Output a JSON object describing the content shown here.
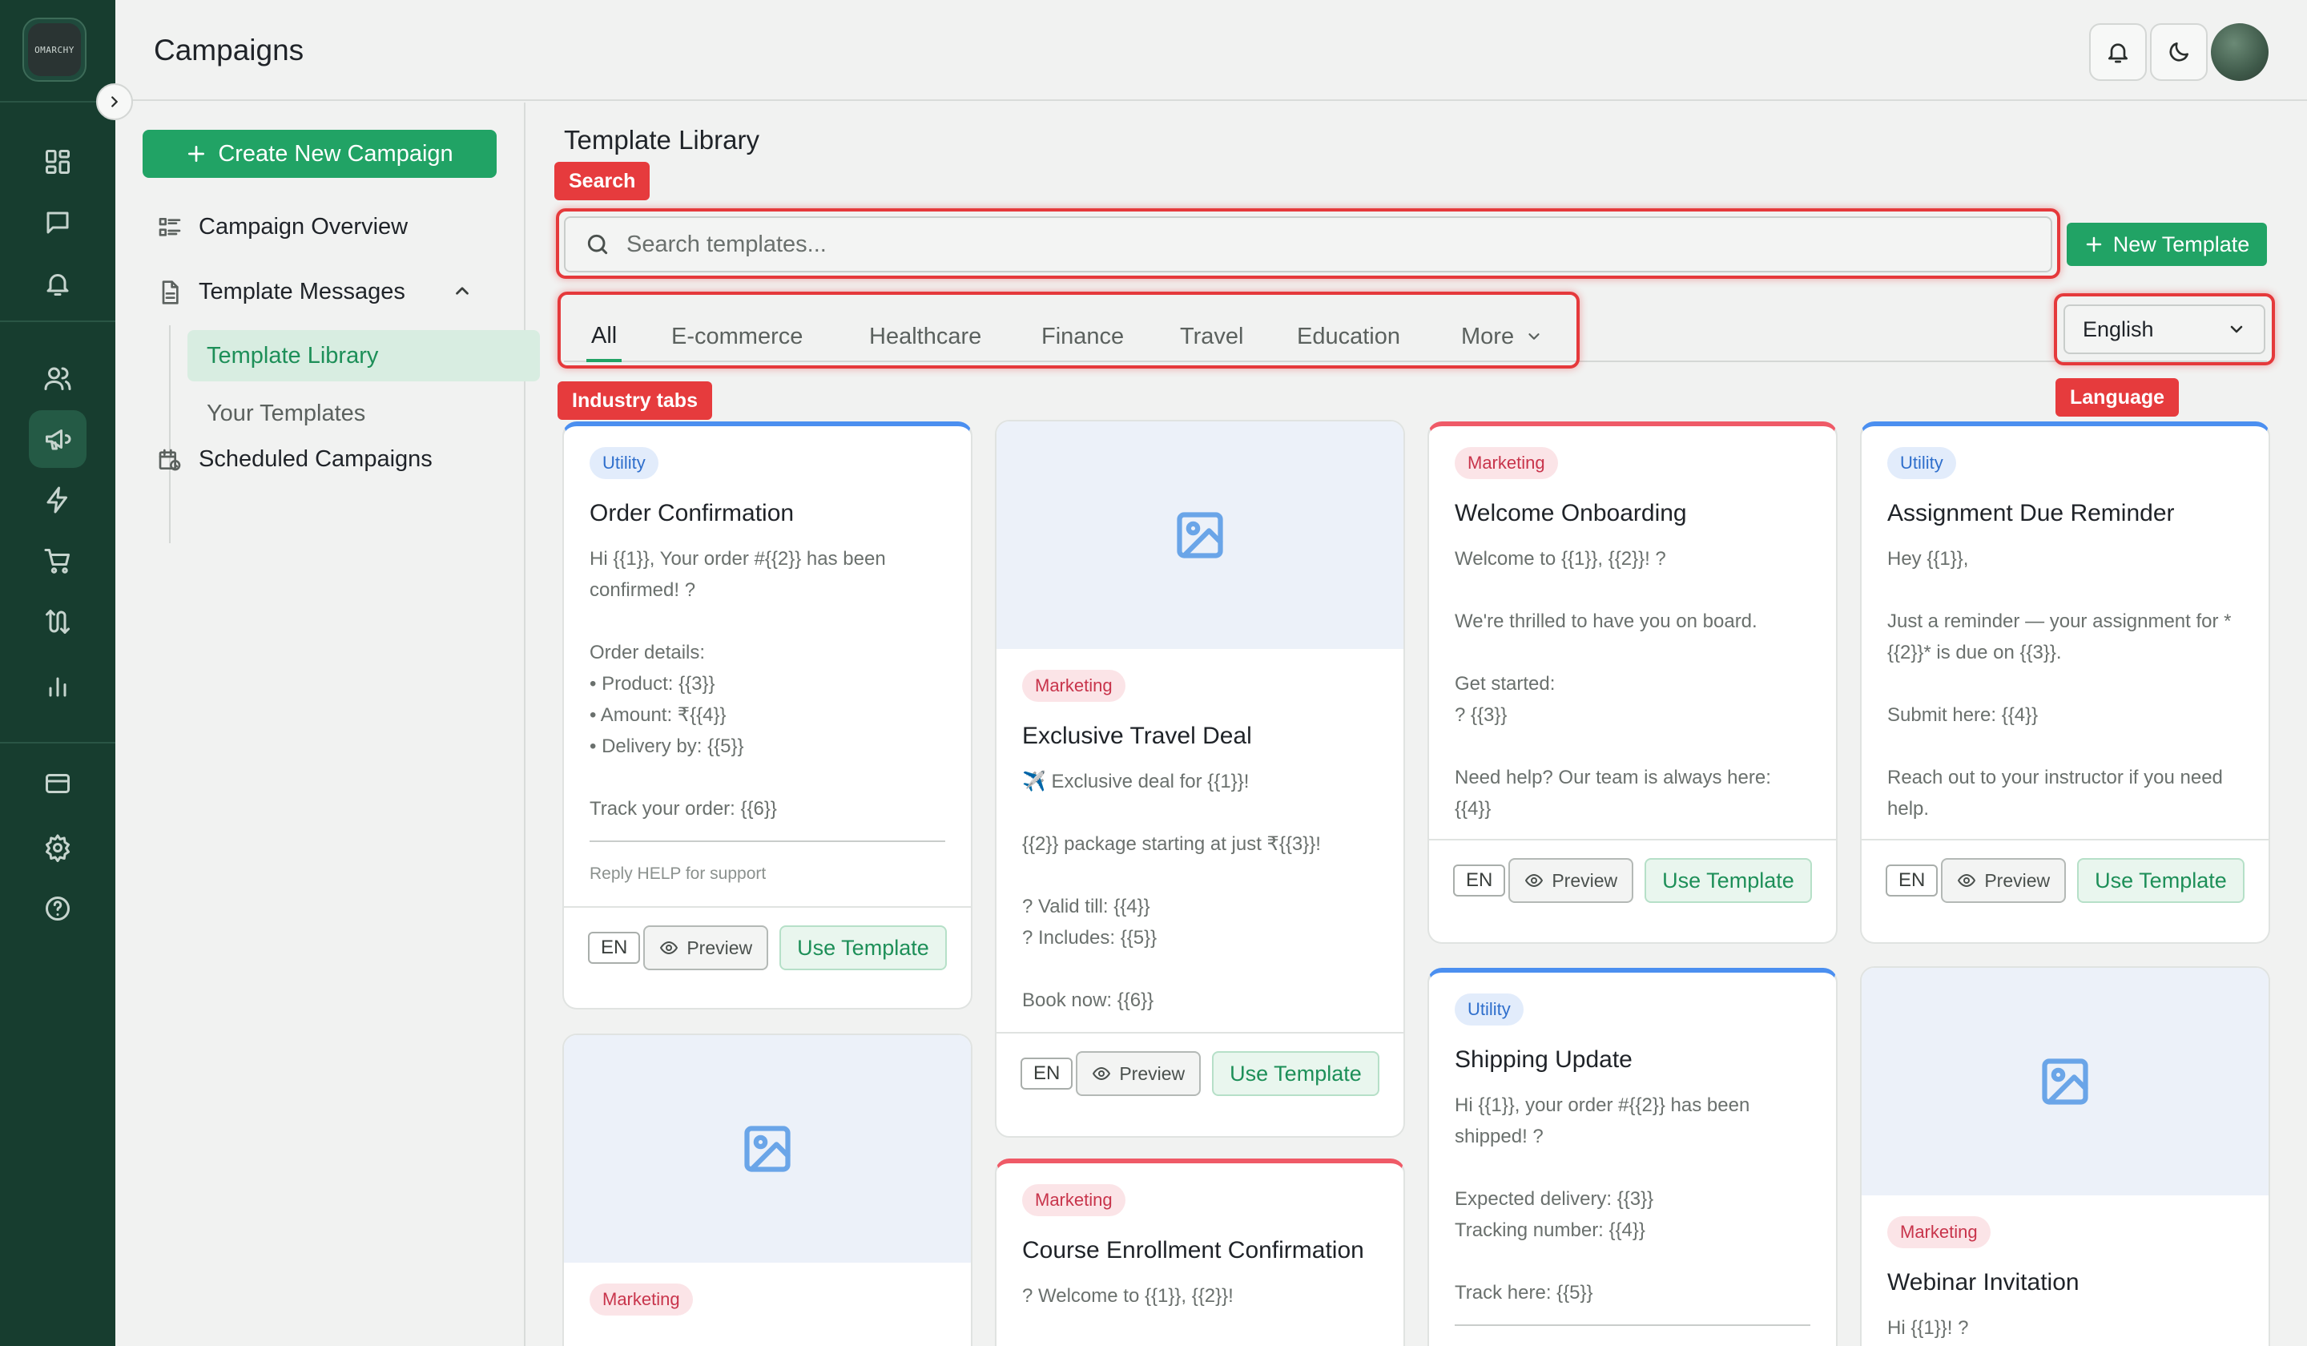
{
  "app": {
    "logo_text": "OMARCHY"
  },
  "header": {
    "title": "Campaigns"
  },
  "sidebar": {
    "create_label": "Create New Campaign",
    "overview_label": "Campaign Overview",
    "template_messages_label": "Template Messages",
    "sub_items": [
      {
        "label": "Template Library",
        "active": true
      },
      {
        "label": "Your Templates",
        "active": false
      }
    ],
    "scheduled_label": "Scheduled Campaigns"
  },
  "main": {
    "title": "Template Library",
    "search": {
      "placeholder": "Search templates..."
    },
    "new_template_label": "New Template",
    "tabs": [
      {
        "label": "All",
        "active": true
      },
      {
        "label": "E-commerce"
      },
      {
        "label": "Healthcare"
      },
      {
        "label": "Finance"
      },
      {
        "label": "Travel"
      },
      {
        "label": "Education"
      },
      {
        "label": "More"
      }
    ],
    "language": {
      "selected": "English"
    }
  },
  "annotations": {
    "search": "Search",
    "industry_tabs": "Industry tabs",
    "language": "Language"
  },
  "actions": {
    "lang": "EN",
    "preview": "Preview",
    "use": "Use Template"
  },
  "cards": [
    {
      "category": "Utility",
      "title": "Order Confirmation",
      "body": "Hi {{1}}, Your order #{{2}} has been confirmed! ?\n\nOrder details:\n• Product: {{3}}\n• Amount: ₹{{4}}\n• Delivery by: {{5}}\n\nTrack your order: {{6}}",
      "footer": "Reply HELP for support"
    },
    {
      "category": "Marketing",
      "title": "Exclusive Travel Deal",
      "body": "✈️ Exclusive deal for {{1}}!\n\n{{2}} package starting at just ₹{{3}}!\n\n? Valid till: {{4}}\n? Includes: {{5}}\n\nBook now: {{6}}"
    },
    {
      "category": "Marketing",
      "title": "Welcome Onboarding",
      "body": "Welcome to {{1}}, {{2}}! ?\n\nWe're thrilled to have you on board.\n\nGet started:\n? {{3}}\n\nNeed help? Our team is always here:\n{{4}}"
    },
    {
      "category": "Utility",
      "title": "Assignment Due Reminder",
      "body": "Hey {{1}},\n\nJust a reminder — your assignment for *{{2}}* is due on {{3}}.\n\nSubmit here: {{4}}\n\nReach out to your instructor if you need help."
    },
    {
      "category": "Marketing",
      "title": "",
      "body": ""
    },
    {
      "category": "Marketing",
      "title": "Course Enrollment Confirmation",
      "body": "? Welcome to {{1}}, {{2}}!"
    },
    {
      "category": "Utility",
      "title": "Shipping Update",
      "body": "Hi {{1}}, your order #{{2}} has been shipped! ?\n\nExpected delivery: {{3}}\nTracking number: {{4}}\n\nTrack here: {{5}}"
    },
    {
      "category": "Marketing",
      "title": "Webinar Invitation",
      "body": "Hi {{1}}! ?"
    }
  ],
  "colors": {
    "rail": "#173d2f",
    "accent": "#21a365",
    "utility": "#4b8ff0",
    "marketing": "#ef5a67",
    "highlight": "#e5393b"
  }
}
